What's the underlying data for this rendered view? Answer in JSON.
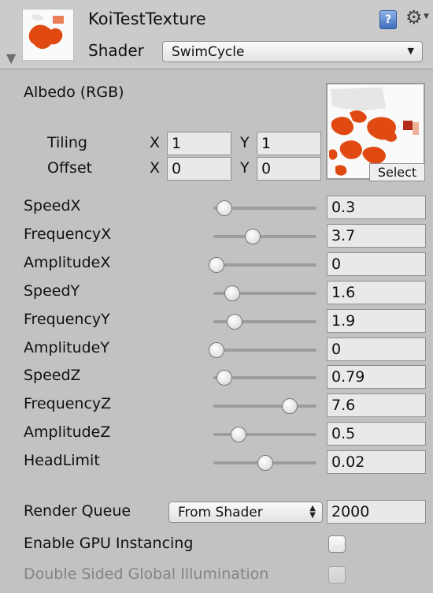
{
  "header": {
    "title": "KoiTestTexture",
    "shader_label": "Shader",
    "shader_value": "SwimCycle"
  },
  "albedo": {
    "label": "Albedo (RGB)",
    "select_label": "Select",
    "tiling_label": "Tiling",
    "offset_label": "Offset",
    "x_label": "X",
    "y_label": "Y",
    "tiling_x": "1",
    "tiling_y": "1",
    "offset_x": "0",
    "offset_y": "0"
  },
  "sliders": [
    {
      "label": "SpeedX",
      "value": "0.3",
      "fraction": 0.08
    },
    {
      "label": "FrequencyX",
      "value": "3.7",
      "fraction": 0.37
    },
    {
      "label": "AmplitudeX",
      "value": "0",
      "fraction": 0.0
    },
    {
      "label": "SpeedY",
      "value": "1.6",
      "fraction": 0.16
    },
    {
      "label": "FrequencyY",
      "value": "1.9",
      "fraction": 0.19
    },
    {
      "label": "AmplitudeY",
      "value": "0",
      "fraction": 0.0
    },
    {
      "label": "SpeedZ",
      "value": "0.79",
      "fraction": 0.079
    },
    {
      "label": "FrequencyZ",
      "value": "7.6",
      "fraction": 0.76
    },
    {
      "label": "AmplitudeZ",
      "value": "0.5",
      "fraction": 0.23
    },
    {
      "label": "HeadLimit",
      "value": "0.02",
      "fraction": 0.5
    }
  ],
  "render_queue": {
    "label": "Render Queue",
    "mode": "From Shader",
    "value": "2000"
  },
  "gpu_instancing": {
    "label": "Enable GPU Instancing",
    "checked": false
  },
  "double_sided_gi": {
    "label": "Double Sided Global Illumination",
    "checked": false,
    "enabled": false
  },
  "colors": {
    "texture_orange": "#e04a12",
    "texture_red": "#b22a18",
    "panel_bg": "#c2c2c2",
    "header_bg": "#cbcbcb"
  },
  "icons": {
    "help": "help-book-icon",
    "settings": "gear-icon",
    "foldout": "foldout-triangle-icon"
  }
}
